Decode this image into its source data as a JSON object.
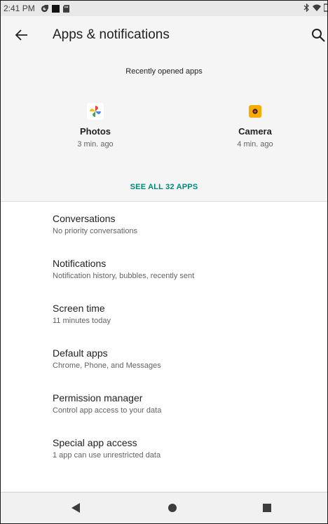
{
  "status_bar": {
    "time": "2:41 PM"
  },
  "app_bar": {
    "title": "Apps & notifications"
  },
  "recent": {
    "title": "Recently opened apps",
    "apps": [
      {
        "name": "Photos",
        "time": "3 min. ago",
        "icon": "photos-icon"
      },
      {
        "name": "Camera",
        "time": "4 min. ago",
        "icon": "camera-icon"
      }
    ],
    "see_all": "SEE ALL 32 APPS"
  },
  "settings": [
    {
      "title": "Conversations",
      "subtitle": "No priority conversations"
    },
    {
      "title": "Notifications",
      "subtitle": "Notification history, bubbles, recently sent"
    },
    {
      "title": "Screen time",
      "subtitle": "11 minutes today"
    },
    {
      "title": "Default apps",
      "subtitle": "Chrome, Phone, and Messages"
    },
    {
      "title": "Permission manager",
      "subtitle": "Control app access to your data"
    },
    {
      "title": "Special app access",
      "subtitle": "1 app can use unrestricted data"
    }
  ],
  "colors": {
    "accent": "#00897b",
    "header_bg": "#f5f5f5",
    "status_bar_bg": "#e8e8e8"
  }
}
